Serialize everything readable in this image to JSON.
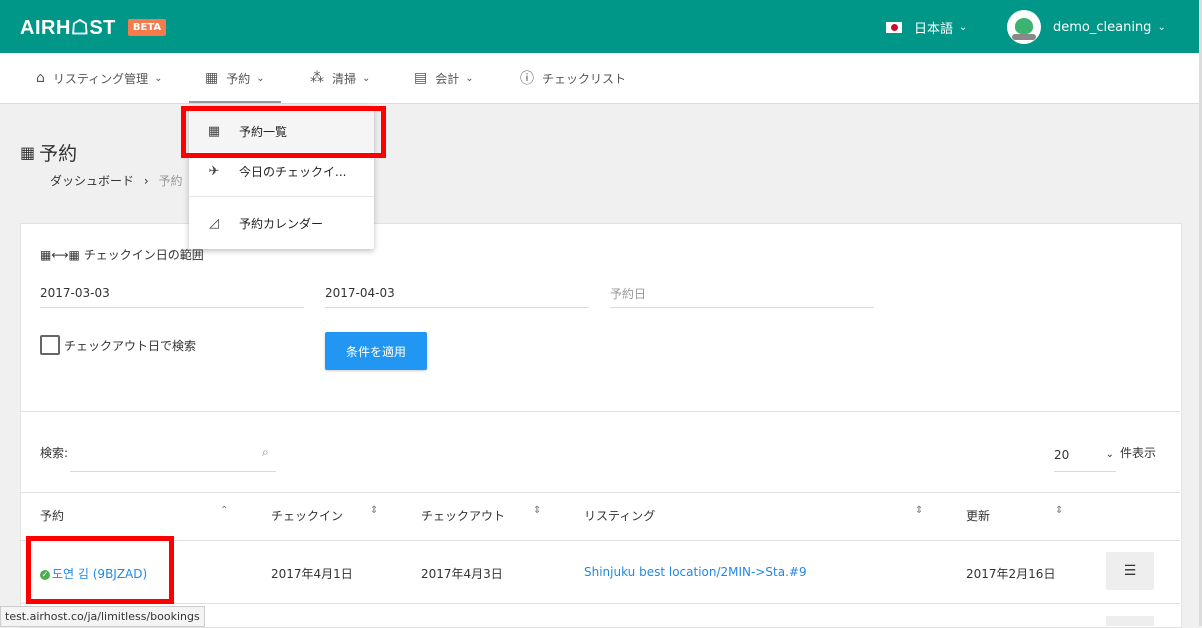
{
  "header": {
    "logo": "AIRH☖ST",
    "beta": "BETA",
    "language": "日本語",
    "username": "demo_cleaning"
  },
  "nav": {
    "items": [
      {
        "label": "リスティング管理",
        "icon": "home-icon"
      },
      {
        "label": "予約",
        "icon": "calendar-icon"
      },
      {
        "label": "清掃",
        "icon": "broom-icon"
      },
      {
        "label": "会計",
        "icon": "calculator-icon"
      },
      {
        "label": "チェックリスト",
        "icon": "question-icon"
      }
    ]
  },
  "dropdown": {
    "items": [
      {
        "label": "予約一覧",
        "icon": "calendar-list-icon"
      },
      {
        "label": "今日のチェックイ...",
        "icon": "plane-arrival-icon"
      },
      {
        "label": "予約カレンダー",
        "icon": "area-chart-icon"
      }
    ]
  },
  "page": {
    "title": "予約",
    "breadcrumb_home": "ダッシュボード",
    "breadcrumb_sep": "›",
    "breadcrumb_current": "予約"
  },
  "filters": {
    "range_label": "チェックイン日の範囲",
    "start_date": "2017-03-03",
    "end_date": "2017-04-03",
    "booking_date_placeholder": "予約日",
    "checkout_search_label": "チェックアウト日で検索",
    "checkout_search_checked": false,
    "apply_label": "条件を適用"
  },
  "table_controls": {
    "search_label": "検索:",
    "page_length": "20",
    "page_length_label": "件表示"
  },
  "table": {
    "columns": [
      "予約",
      "チェックイン",
      "チェックアウト",
      "リスティング",
      "更新"
    ],
    "rows": [
      {
        "booking": "도연 김 (9BJZAD)",
        "checkin": "2017年4月1日",
        "checkout": "2017年4月3日",
        "listing": "Shinjuku best location/2MIN->Sta.#9",
        "updated": "2017年2月16日"
      }
    ]
  },
  "status_url": "test.airhost.co/ja/limitless/bookings",
  "colors": {
    "header": "#009688",
    "beta": "#f47c4c",
    "primary_button": "#2196f3",
    "link": "#1e88e5",
    "highlight": "#ff0000",
    "status_ok": "#4caf50"
  }
}
